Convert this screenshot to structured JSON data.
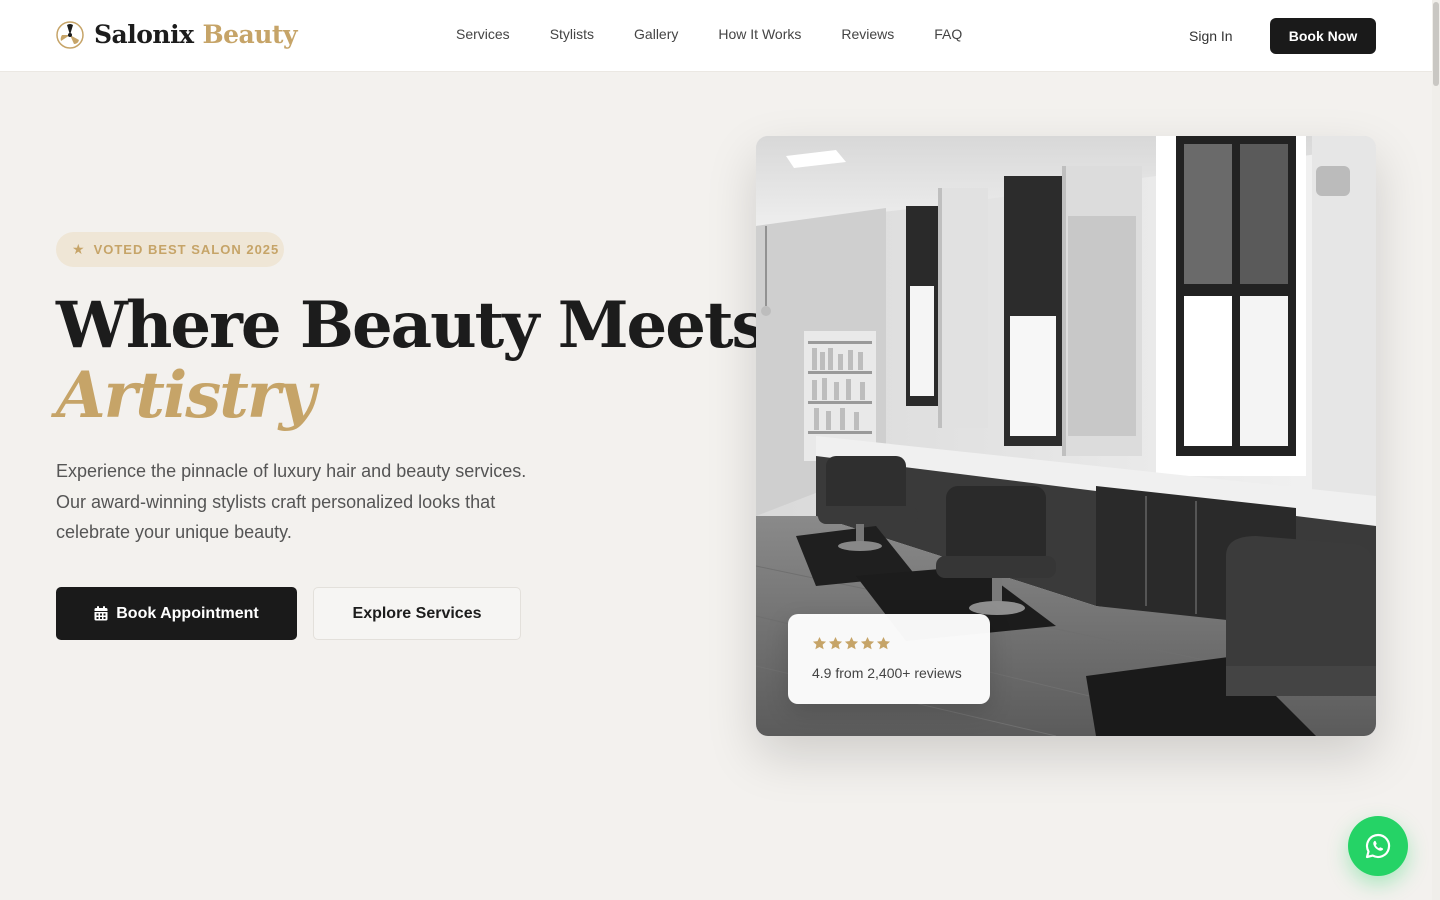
{
  "brand": {
    "name": "Salonix",
    "accent": "Beauty",
    "accent_color": "#c6a468",
    "logo_icon": "propeller-logo-icon"
  },
  "nav": {
    "items": [
      {
        "label": "Services"
      },
      {
        "label": "Stylists"
      },
      {
        "label": "Gallery"
      },
      {
        "label": "How It Works"
      },
      {
        "label": "Reviews"
      },
      {
        "label": "FAQ"
      }
    ],
    "sign_in": "Sign In",
    "book_now": "Book Now"
  },
  "hero": {
    "badge": "VOTED BEST SALON 2025",
    "badge_icon": "star-icon",
    "title": "Where Beauty Meets",
    "title_accent": "Artistry",
    "description": "Experience the pinnacle of luxury hair and beauty services. Our award-winning stylists craft personalized looks that celebrate your unique beauty.",
    "primary_button": "Book Appointment",
    "primary_button_icon": "calendar-icon",
    "secondary_button": "Explore Services"
  },
  "review_card": {
    "rating_stars": 5,
    "text": "4.9 from 2,400+ reviews"
  },
  "whatsapp": {
    "icon": "whatsapp-icon",
    "color": "#25d366"
  }
}
